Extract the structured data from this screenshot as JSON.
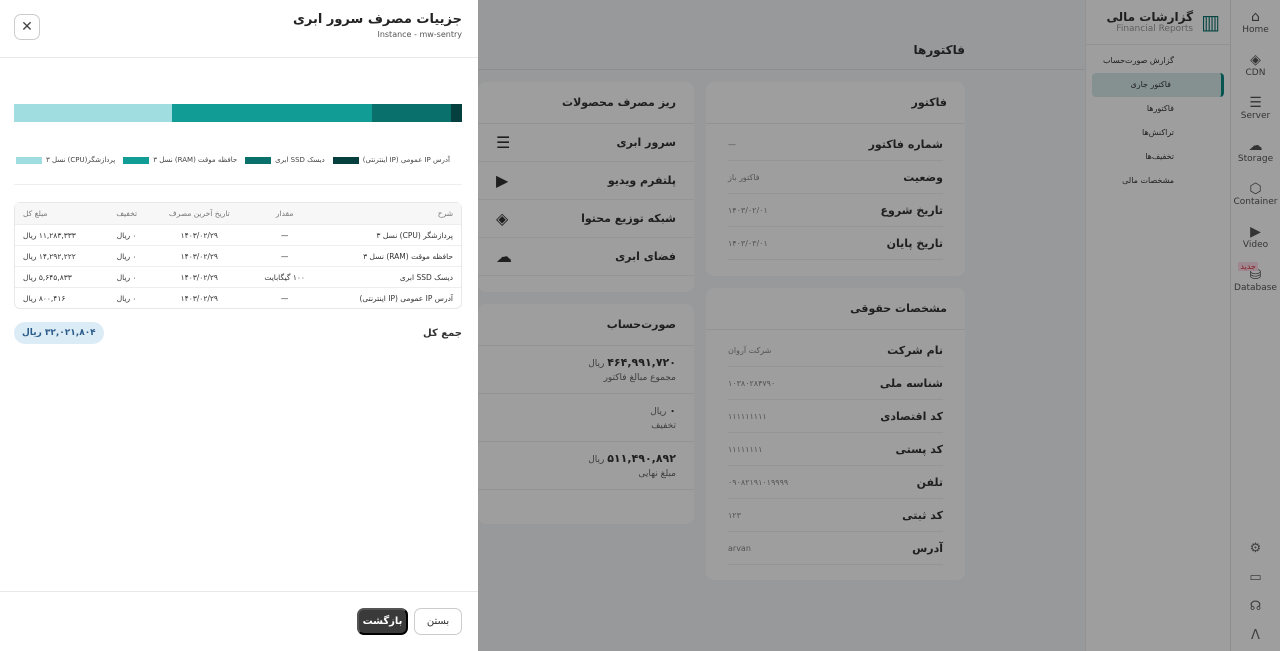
{
  "rail": {
    "items": [
      {
        "label": "Home",
        "icon": "home-icon"
      },
      {
        "label": "CDN",
        "icon": "cdn-icon"
      },
      {
        "label": "Server",
        "icon": "server-icon"
      },
      {
        "label": "Storage",
        "icon": "storage-icon"
      },
      {
        "label": "Container",
        "icon": "container-icon"
      },
      {
        "label": "Video",
        "icon": "video-icon"
      },
      {
        "label": "Database",
        "icon": "database-icon"
      }
    ],
    "new_badge": "جدید"
  },
  "subnav": {
    "title": "گزارشات مالی",
    "subtitle": "Financial Reports",
    "items": [
      "گزارش صورت‌حساب",
      "فاکتور جاری",
      "فاکتورها",
      "تراکنش‌ها",
      "تخفیف‌ها",
      "مشخصات مالی"
    ],
    "active": 1
  },
  "page_title": "فاکتورها",
  "invoice": {
    "title": "فاکتور",
    "rows": [
      {
        "k": "شماره فاکتور",
        "v": "—"
      },
      {
        "k": "وضعیت",
        "v": "فاکتور باز"
      },
      {
        "k": "تاریخ شروع",
        "v": "۱۴۰۳/۰۲/۰۱"
      },
      {
        "k": "تاریخ پایان",
        "v": "۱۴۰۳/۰۳/۰۱"
      }
    ]
  },
  "legal": {
    "title": "مشخصات حقوقی",
    "rows": [
      {
        "k": "نام شرکت",
        "v": "شرکت آروان"
      },
      {
        "k": "شناسه ملی",
        "v": "۱۰۳۸۰۲۸۴۷۹۰"
      },
      {
        "k": "کد اقتصادی",
        "v": "۱۱۱۱۱۱۱۱۱"
      },
      {
        "k": "کد پستی",
        "v": "۱۱۱۱۱۱۱۱"
      },
      {
        "k": "تلفن",
        "v": "۰۹۰۸۲۱۹۱۰۱۹۹۹۹"
      },
      {
        "k": "کد ثبتی",
        "v": "۱۲۳"
      },
      {
        "k": "آدرس",
        "v": "arvan"
      }
    ]
  },
  "products": {
    "title": "ریز مصرف محصولات",
    "items": [
      "سرور ابری",
      "پلتفرم ویدیو",
      "شبکه توزیع محتوا",
      "فضای ابری"
    ]
  },
  "statement": {
    "title": "صورت‌حساب",
    "rows": [
      {
        "amount": "۴۶۴,۹۹۱,۷۲۰",
        "unit": "ریال",
        "label": "مجموع مبالغ فاکتور"
      },
      {
        "amount": "۰",
        "unit": "ریال",
        "label": "تخفیف"
      },
      {
        "amount": "۵۱۱,۴۹۰,۸۹۲",
        "unit": "ریال",
        "label": "مبلغ نهایی"
      }
    ]
  },
  "drawer": {
    "title": "جزییات مصرف سرور ابری",
    "subtitle": "Instance - mw-sentry",
    "usage_shares": [
      {
        "name": "پردازشگر(CPU) نسل ۳",
        "value": 11283333,
        "color": "#9fdde0"
      },
      {
        "name": "حافظه موقت (RAM) نسل ۳",
        "value": 14292222,
        "color": "#129c96"
      },
      {
        "name": "دیسک SSD ابری",
        "value": 5645833,
        "color": "#0a706c"
      },
      {
        "name": "آدرس IP عمومی (IP اینترنتی)",
        "value": 800416,
        "color": "#06403e"
      }
    ],
    "table": {
      "headers": [
        "شرح",
        "مقدار",
        "تاریخ آخرین مصرف",
        "تخفیف",
        "مبلغ کل"
      ],
      "rows": [
        [
          "پردازشگر (CPU) نسل ۳",
          "—",
          "۱۴۰۳/۰۲/۲۹",
          "۰ ریال",
          "۱۱,۲۸۳,۳۳۳ ریال"
        ],
        [
          "حافظه موقت (RAM) نسل ۳",
          "—",
          "۱۴۰۳/۰۲/۲۹",
          "۰ ریال",
          "۱۴,۲۹۲,۲۲۲ ریال"
        ],
        [
          "دیسک SSD ابری",
          "۱۰۰ گیگابایت",
          "۱۴۰۳/۰۲/۲۹",
          "۰ ریال",
          "۵,۶۴۵,۸۳۳ ریال"
        ],
        [
          "آدرس IP عمومی (IP اینترنتی)",
          "—",
          "۱۴۰۳/۰۲/۲۹",
          "۰ ریال",
          "۸۰۰,۴۱۶ ریال"
        ]
      ]
    },
    "total_label": "جمع کل",
    "total_value": "۳۲,۰۲۱,۸۰۴ ریال",
    "back_label": "بازگشت",
    "close_label": "بستن"
  }
}
